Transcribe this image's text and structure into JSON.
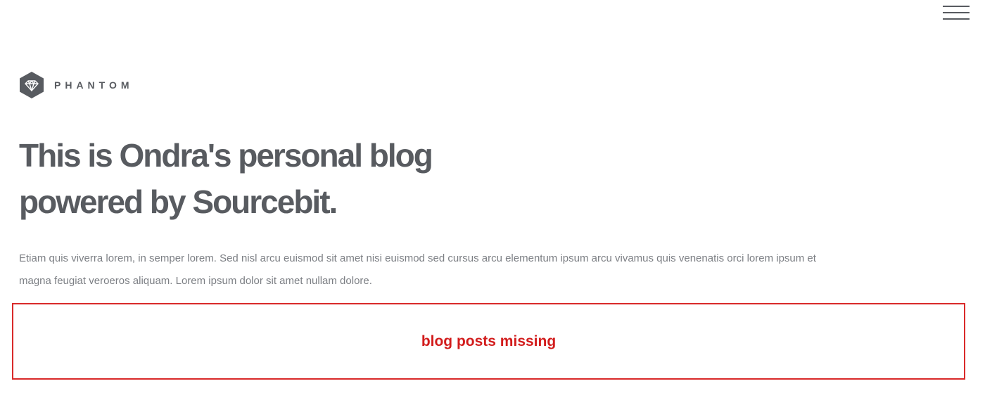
{
  "header": {
    "menu_icon": "hamburger-menu-icon"
  },
  "logo": {
    "icon": "diamond-hexagon-icon",
    "text": "PHANTOM",
    "color": "#585b60"
  },
  "hero": {
    "headline_line1": "This is Ondra's personal blog",
    "headline_line2": "powered by Sourcebit.",
    "intro": "Etiam quis viverra lorem, in semper lorem. Sed nisl arcu euismod sit amet nisi euismod sed cursus arcu elementum ipsum arcu vivamus quis venenatis orci lorem ipsum et magna feugiat veroeros aliquam. Lorem ipsum dolor sit amet nullam dolore."
  },
  "posts_placeholder": {
    "message": "blog posts missing",
    "color": "#d21c1c"
  }
}
